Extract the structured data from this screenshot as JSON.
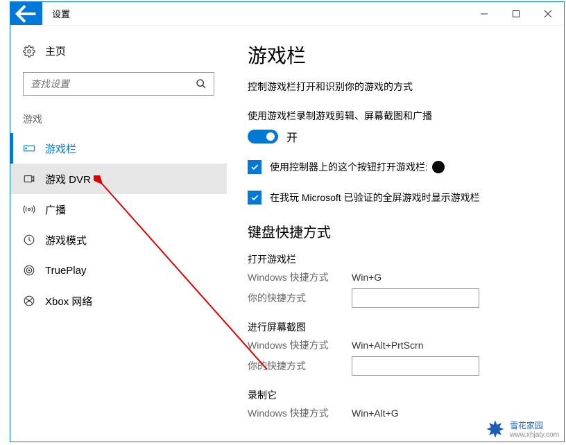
{
  "titlebar": {
    "title": "设置"
  },
  "sidebar": {
    "home": "主页",
    "search_placeholder": "查找设置",
    "category": "游戏",
    "items": [
      {
        "label": "游戏栏"
      },
      {
        "label": "游戏 DVR"
      },
      {
        "label": "广播"
      },
      {
        "label": "游戏模式"
      },
      {
        "label": "TruePlay"
      },
      {
        "label": "Xbox 网络"
      }
    ]
  },
  "content": {
    "heading": "游戏栏",
    "desc": "控制游戏栏打开和识别你的游戏的方式",
    "toggle_desc": "使用游戏栏录制游戏剪辑、屏幕截图和广播",
    "toggle_state": "开",
    "checkbox1": "使用控制器上的这个按钮打开游戏栏:",
    "checkbox2": "在我玩 Microsoft 已验证的全屏游戏时显示游戏栏",
    "shortcuts_heading": "键盘快捷方式",
    "groups": [
      {
        "title": "打开游戏栏",
        "win_label": "Windows 快捷方式",
        "win_value": "Win+G",
        "your_label": "你的快捷方式"
      },
      {
        "title": "进行屏幕截图",
        "win_label": "Windows 快捷方式",
        "win_value": "Win+Alt+PrtScrn",
        "your_label": "你的快捷方式"
      },
      {
        "title": "录制它",
        "win_label": "Windows 快捷方式",
        "win_value": "Win+Alt+G"
      }
    ]
  },
  "watermark": {
    "name": "雪花家园",
    "url": "www.xhjaty.com"
  }
}
